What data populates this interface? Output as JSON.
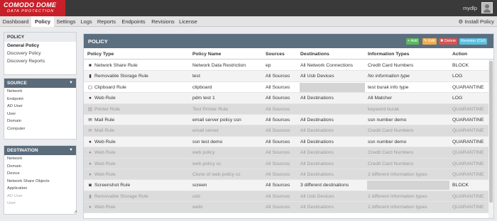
{
  "brand": {
    "line1": "COMODO DOME",
    "line2": "DATA PROTECTION"
  },
  "user": {
    "name": "mydlp"
  },
  "nav": {
    "tabs": [
      "Dashboard",
      "Policy",
      "Settings",
      "Logs",
      "Reports",
      "Endpoints",
      "Revisions",
      "License"
    ],
    "active": "Policy",
    "install_label": "Install Policy"
  },
  "sidebar": {
    "policy": {
      "title": "POLICY",
      "items": [
        "General Policy",
        "Discovery Policy",
        "Discovery Reports"
      ]
    },
    "source": {
      "title": "SOURCE",
      "items": [
        "Network",
        "Endpoint",
        "AD User",
        "User",
        "Domain",
        "Computer"
      ]
    },
    "destination": {
      "title": "DESTINATION",
      "items": [
        "Network",
        "Domain",
        "Device",
        "Network Share Objects",
        "Application",
        "AD User",
        "User"
      ]
    }
  },
  "main": {
    "title": "POLICY",
    "buttons": {
      "add": "+ Add",
      "edit": "✎ Edit",
      "delete": "✖ Delete",
      "revision": "Revision (Ctrl)"
    },
    "columns": [
      "Policy Type",
      "Policy Name",
      "Sources",
      "Destinations",
      "Information Types",
      "Action"
    ],
    "rows": [
      {
        "type": "Network Share Rule",
        "icon": "network-share-icon",
        "name": "Network Data Restriction",
        "sources": "ep",
        "destinations": "All Network Connections",
        "info": "Credit Card Numbers",
        "action": "BLOCK",
        "disabled": false
      },
      {
        "type": "Removable Storage Rule",
        "icon": "usb-icon",
        "name": "test",
        "sources": "All Sources",
        "destinations": "All Usb Devices",
        "info": "No information type",
        "info_italic": true,
        "action": "LOG",
        "disabled": false
      },
      {
        "type": "Clipboard Rule",
        "icon": "clipboard-icon",
        "name": "clipboard",
        "sources": "All Sources",
        "destinations": "",
        "dest_box": true,
        "info": "test burak info type",
        "action": "QUARANTINE",
        "disabled": false
      },
      {
        "type": "Web Rule",
        "icon": "globe-icon",
        "name": "pdm test 1",
        "sources": "All Sources",
        "destinations": "All Destinations",
        "info": "All Matcher",
        "action": "LOG",
        "disabled": false
      },
      {
        "type": "Printer Rule",
        "icon": "printer-icon",
        "name": "Test Printer Rule",
        "sources": "All Sources",
        "destinations": "",
        "info": "keyword burak",
        "action": "QUARANTINE",
        "disabled": true
      },
      {
        "type": "Mail Rule",
        "icon": "mail-icon",
        "name": "email server policy ssn",
        "sources": "All Sources",
        "destinations": "All Destinations",
        "info": "ssn number demo",
        "action": "QUARANTINE",
        "disabled": false
      },
      {
        "type": "Mail Rule",
        "icon": "mail-icon",
        "name": "email server",
        "sources": "All Sources",
        "destinations": "All Destinations",
        "info": "Credit Card Numbers",
        "action": "QUARANTINE",
        "disabled": true
      },
      {
        "type": "Web Rule",
        "icon": "globe-icon",
        "name": "ssn test demo",
        "sources": "All Sources",
        "destinations": "All Destinations",
        "info": "ssn number demo",
        "action": "QUARANTINE",
        "disabled": false
      },
      {
        "type": "Web Rule",
        "icon": "globe-icon",
        "name": "web policy",
        "sources": "All Sources",
        "destinations": "All Destinations",
        "info": "Credit Card Numbers",
        "action": "QUARANTINE",
        "disabled": true
      },
      {
        "type": "Web Rule",
        "icon": "globe-icon",
        "name": "web policy cc",
        "sources": "All Sources",
        "destinations": "All Destinations",
        "info": "Credit Card Numbers",
        "action": "QUARANTINE",
        "disabled": true
      },
      {
        "type": "Web Rule",
        "icon": "globe-icon",
        "name": "Clone of web policy cc",
        "sources": "All Sources",
        "destinations": "All Destinations",
        "info": "2 different information types",
        "action": "QUARANTINE",
        "disabled": true
      },
      {
        "type": "Screenshot Rule",
        "icon": "camera-icon",
        "name": "screen",
        "sources": "All Sources",
        "destinations": "3 different destinations",
        "info": "",
        "info_box": true,
        "action": "BLOCK",
        "disabled": false
      },
      {
        "type": "Removable Storage Rule",
        "icon": "usb-icon",
        "name": "usb",
        "sources": "All Sources",
        "destinations": "All Usb Devices",
        "info": "2 different information types",
        "action": "QUARANTINE",
        "disabled": true
      },
      {
        "type": "Web Rule",
        "icon": "globe-icon",
        "name": "webr",
        "sources": "All Sources",
        "destinations": "All Destinations",
        "info": "2 different information types",
        "action": "QUARANTINE",
        "disabled": true
      }
    ]
  },
  "icons": {
    "network-share-icon": "■",
    "usb-icon": "▮",
    "clipboard-icon": "▢",
    "globe-icon": "●",
    "printer-icon": "▤",
    "mail-icon": "✉",
    "camera-icon": "◙"
  }
}
